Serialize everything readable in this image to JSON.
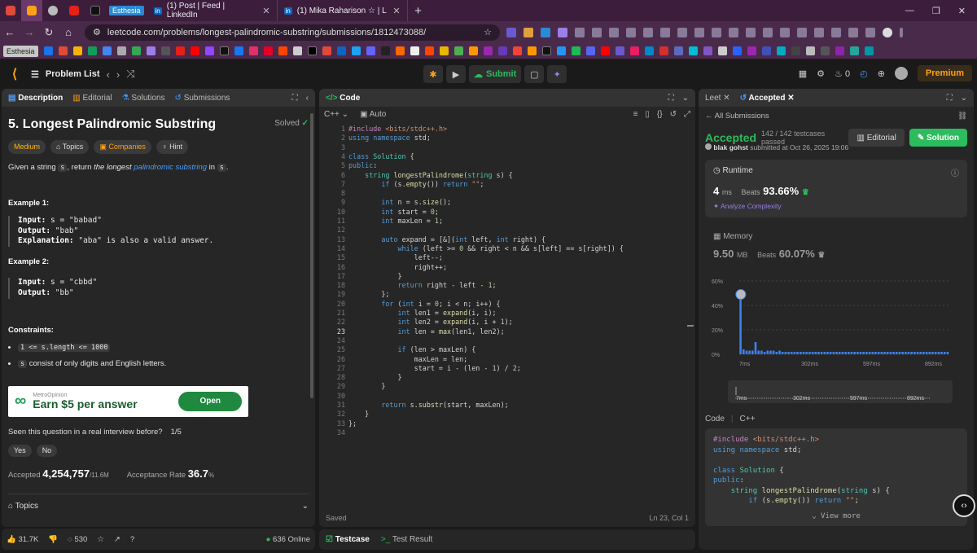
{
  "browser": {
    "tabs": [
      {
        "label": "(1) Post | Feed | LinkedIn"
      },
      {
        "label": "(1) Mika Raharison ☆ | LinkedI"
      }
    ],
    "esthesia_tab": "Esthesia",
    "url": "leetcode.com/problems/longest-palindromic-substring/submissions/1812473088/",
    "bookmark_first": "Esthesia"
  },
  "nav": {
    "problem_list": "Problem List",
    "submit": "Submit",
    "counter": "0",
    "premium": "Premium"
  },
  "description": {
    "tabs": [
      "Description",
      "Editorial",
      "Solutions",
      "Submissions"
    ],
    "title": "5. Longest Palindromic Substring",
    "solved": "Solved",
    "chips": {
      "difficulty": "Medium",
      "topics": "Topics",
      "companies": "Companies",
      "hint": "Hint"
    },
    "statement": {
      "p1": "Given a string ",
      "code": "s",
      "p2": ", return ",
      "em": "the longest ",
      "link": "palindromic substring",
      "p3": " in ",
      "p4": "."
    },
    "ex1": {
      "heading": "Example 1:",
      "input_lbl": "Input:",
      "input": " s = \"babad\"",
      "output_lbl": "Output:",
      "output": " \"bab\"",
      "expl_lbl": "Explanation:",
      "expl": " \"aba\" is also a valid answer."
    },
    "ex2": {
      "heading": "Example 2:",
      "input_lbl": "Input:",
      "input": " s = \"cbbd\"",
      "output_lbl": "Output:",
      "output": " \"bb\""
    },
    "constraints": {
      "heading": "Constraints:",
      "c1": "1 <= s.length <= 1000",
      "c2_code": "s",
      "c2": " consist of only digits and English letters."
    },
    "ad": {
      "brand": "MetroOpinion",
      "text": "Earn $5 per answer",
      "button": "Open"
    },
    "interview": {
      "question": "Seen this question in a real interview before?",
      "count": "1/5",
      "yes": "Yes",
      "no": "No"
    },
    "stats": {
      "accepted_lbl": "Accepted",
      "accepted": "4,254,757",
      "accepted_total": "/11.6M",
      "rate_lbl": "Acceptance Rate",
      "rate": "36.7",
      "rate_unit": "%"
    },
    "topics": "Topics",
    "footer": {
      "likes": "31.7K",
      "comments": "530",
      "online": "636 Online"
    }
  },
  "code": {
    "title": "Code",
    "language": "C++",
    "mode": "Auto",
    "status": "Saved",
    "cursor": "Ln 23, Col 1",
    "current_line": 23
  },
  "bottom": {
    "testcase": "Testcase",
    "result": "Test Result"
  },
  "result": {
    "tabs": [
      "Leet",
      "Accepted"
    ],
    "all_submissions": "All Submissions",
    "status": "Accepted",
    "passed": "142 / 142 testcases passed",
    "editorial": "Editorial",
    "solution": "Solution",
    "user": "blak gohst",
    "submitted": " submitted at Oct 26, 2025 19:06",
    "runtime": {
      "label": "Runtime",
      "value": "4",
      "unit": "ms",
      "beats_lbl": "Beats",
      "beats": "93.66%",
      "analyze": "Analyze Complexity"
    },
    "memory": {
      "label": "Memory",
      "value": "9.50",
      "unit": "MB",
      "beats_lbl": "Beats",
      "beats": "60.07%"
    },
    "code_header": {
      "code": "Code",
      "lang": "C++"
    },
    "view_more": "View more"
  },
  "chart_data": {
    "type": "bar",
    "y_ticks": [
      "60%",
      "40%",
      "20%",
      "0%"
    ],
    "x_ticks": [
      "7ms",
      "302ms",
      "597ms",
      "892ms"
    ],
    "ylim": [
      0,
      60
    ],
    "values": [
      45,
      4,
      3,
      3,
      3,
      10,
      3,
      3,
      2,
      3,
      3,
      3,
      2,
      3,
      2,
      2,
      2,
      2,
      2,
      2,
      2,
      2,
      2,
      2,
      2,
      2,
      2,
      2,
      2,
      2,
      2,
      2,
      2,
      2,
      2,
      2,
      2,
      2,
      2,
      2,
      2,
      2,
      2,
      2,
      2,
      2,
      2,
      2,
      2,
      2,
      2,
      2,
      2,
      2,
      2,
      2,
      2,
      2,
      2,
      2,
      2,
      2,
      2,
      2,
      2,
      2,
      2,
      2,
      2,
      2
    ],
    "highlight_index": 0,
    "colors": {
      "bar": "#3b82f6",
      "grid": "#444444"
    }
  },
  "code_lines": [
    [
      [
        "pp",
        "#include "
      ],
      [
        "st",
        "<bits/stdc++.h>"
      ]
    ],
    [
      [
        "kw",
        "using namespace "
      ],
      [
        "",
        "std;"
      ]
    ],
    [],
    [
      [
        "kw",
        "class "
      ],
      [
        "ty",
        "Solution "
      ],
      [
        "",
        "{"
      ]
    ],
    [
      [
        "kw",
        "public"
      ],
      [
        "",
        ":"
      ]
    ],
    [
      [
        "",
        "    "
      ],
      [
        "ty",
        "string "
      ],
      [
        "fn",
        "longestPalindrome"
      ],
      [
        "",
        "("
      ],
      [
        "ty",
        "string "
      ],
      [
        "",
        "s) {"
      ]
    ],
    [
      [
        "",
        "        "
      ],
      [
        "kw",
        "if "
      ],
      [
        "",
        "(s."
      ],
      [
        "fn",
        "empty"
      ],
      [
        "",
        "()) "
      ],
      [
        "kw",
        "return "
      ],
      [
        "st",
        "\"\""
      ],
      [
        "",
        ";"
      ]
    ],
    [],
    [
      [
        "",
        "        "
      ],
      [
        "kw",
        "int "
      ],
      [
        "",
        "n = s."
      ],
      [
        "fn",
        "size"
      ],
      [
        "",
        "();"
      ]
    ],
    [
      [
        "",
        "        "
      ],
      [
        "kw",
        "int "
      ],
      [
        "",
        "start = "
      ],
      [
        "nm",
        "0"
      ],
      [
        "",
        ";"
      ]
    ],
    [
      [
        "",
        "        "
      ],
      [
        "kw",
        "int "
      ],
      [
        "",
        "maxLen = "
      ],
      [
        "nm",
        "1"
      ],
      [
        "",
        ";"
      ]
    ],
    [],
    [
      [
        "",
        "        "
      ],
      [
        "kw",
        "auto "
      ],
      [
        "",
        "expand = [&]("
      ],
      [
        "kw",
        "int "
      ],
      [
        "",
        "left, "
      ],
      [
        "kw",
        "int "
      ],
      [
        "",
        "right) {"
      ]
    ],
    [
      [
        "",
        "            "
      ],
      [
        "kw",
        "while "
      ],
      [
        "",
        "(left >= "
      ],
      [
        "nm",
        "0"
      ],
      [
        "",
        " && right < n && s[left] == s[right]) {"
      ]
    ],
    [
      [
        "",
        "                left--;"
      ]
    ],
    [
      [
        "",
        "                right++;"
      ]
    ],
    [
      [
        "",
        "            }"
      ]
    ],
    [
      [
        "",
        "            "
      ],
      [
        "kw",
        "return "
      ],
      [
        "",
        "right - left - "
      ],
      [
        "nm",
        "1"
      ],
      [
        "",
        ";"
      ]
    ],
    [
      [
        "",
        "        };"
      ]
    ],
    [
      [
        "",
        "        "
      ],
      [
        "kw",
        "for "
      ],
      [
        "",
        "("
      ],
      [
        "kw",
        "int "
      ],
      [
        "",
        "i = "
      ],
      [
        "nm",
        "0"
      ],
      [
        "",
        "; i < n; i++) {"
      ]
    ],
    [
      [
        "",
        "            "
      ],
      [
        "kw",
        "int "
      ],
      [
        "",
        "len1 = "
      ],
      [
        "fn",
        "expand"
      ],
      [
        "",
        "(i, i);"
      ]
    ],
    [
      [
        "",
        "            "
      ],
      [
        "kw",
        "int "
      ],
      [
        "",
        "len2 = "
      ],
      [
        "fn",
        "expand"
      ],
      [
        "",
        "(i, i + "
      ],
      [
        "nm",
        "1"
      ],
      [
        "",
        ");"
      ]
    ],
    [
      [
        "",
        "            "
      ],
      [
        "kw",
        "int "
      ],
      [
        "",
        "len = "
      ],
      [
        "fn",
        "max"
      ],
      [
        "",
        "(len1, len2);"
      ]
    ],
    [],
    [
      [
        "",
        "            "
      ],
      [
        "kw",
        "if "
      ],
      [
        "",
        "(len > maxLen) {"
      ]
    ],
    [
      [
        "",
        "                maxLen = len;"
      ]
    ],
    [
      [
        "",
        "                start = i - (len - "
      ],
      [
        "nm",
        "1"
      ],
      [
        "",
        ") / "
      ],
      [
        "nm",
        "2"
      ],
      [
        "",
        ";"
      ]
    ],
    [
      [
        "",
        "            }"
      ]
    ],
    [
      [
        "",
        "        }"
      ]
    ],
    [],
    [
      [
        "",
        "        "
      ],
      [
        "kw",
        "return "
      ],
      [
        "",
        "s."
      ],
      [
        "fn",
        "substr"
      ],
      [
        "",
        "(start, maxLen);"
      ]
    ],
    [
      [
        "",
        "    }"
      ]
    ],
    [
      [
        "",
        "};"
      ]
    ],
    []
  ]
}
